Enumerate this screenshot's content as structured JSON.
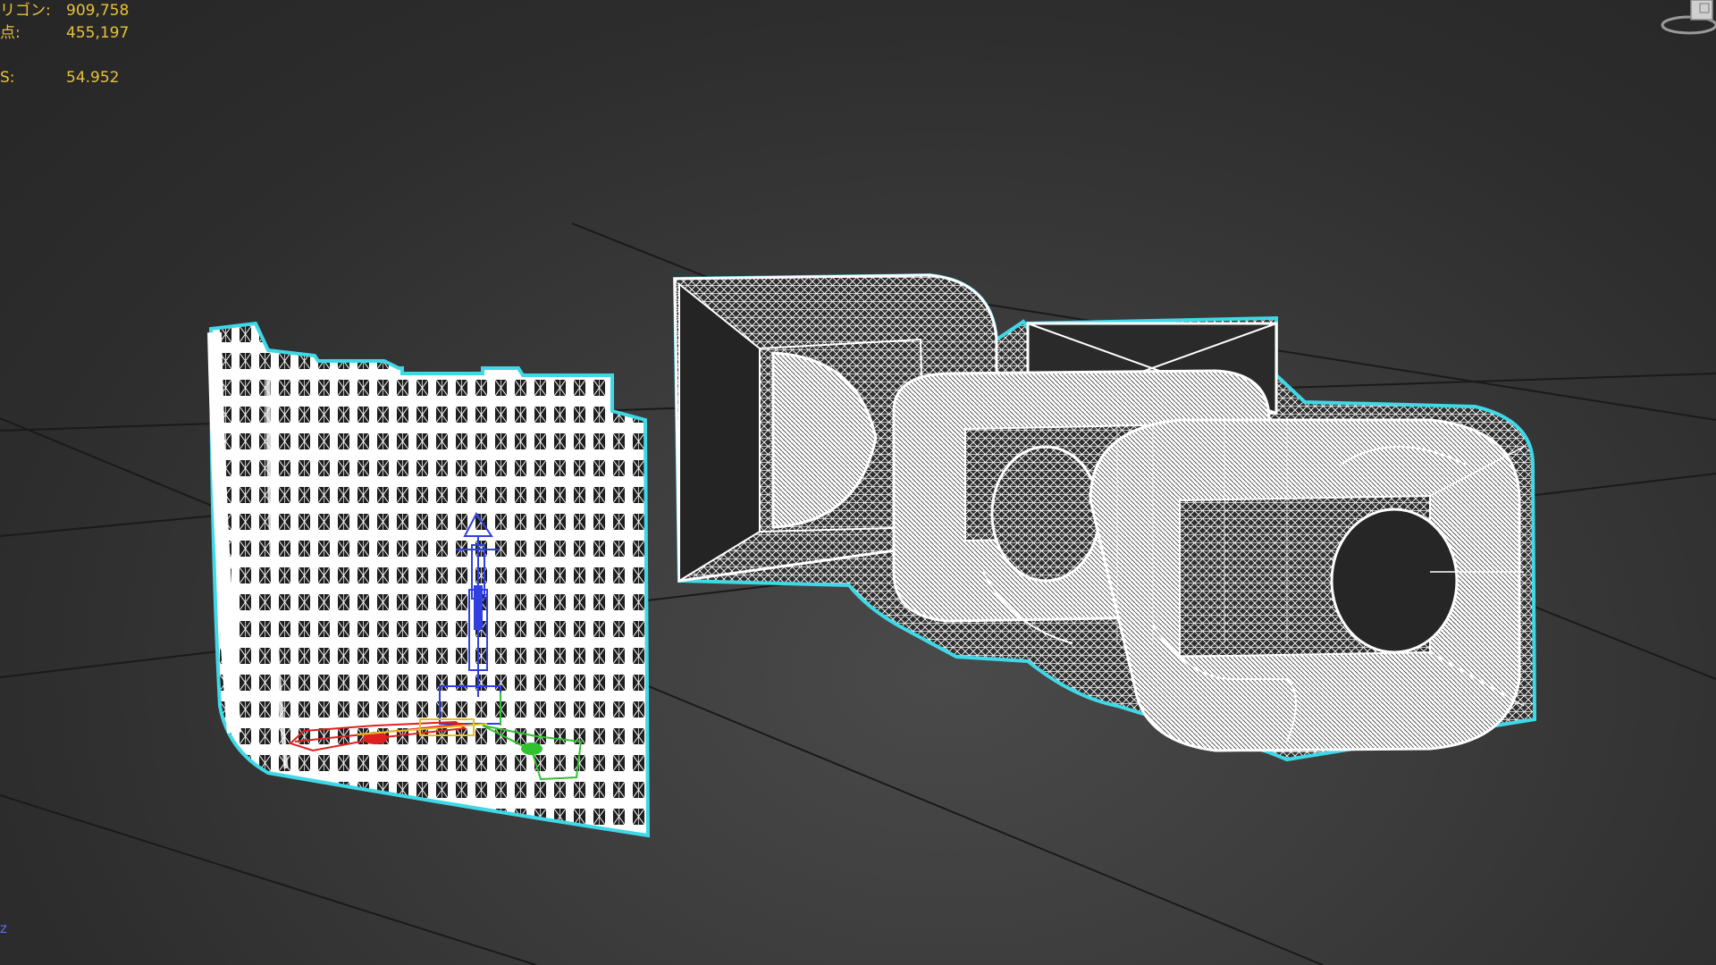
{
  "stats": {
    "polygons": {
      "label": "リゴン:",
      "value": "909,758"
    },
    "vertices": {
      "label": "点:",
      "value": "455,197"
    },
    "fps": {
      "label": "S:",
      "value": "54.952"
    }
  },
  "axis_indicator": {
    "label": "z",
    "color": "#5a6cff"
  },
  "colors": {
    "viewport_bg": "#2b2b2b",
    "grid": "#1a1a1a",
    "wire": "#ffffff",
    "selection_outline": "#3fd8e6",
    "stats_text": "#e6c23b",
    "gizmo_x": "#e02020",
    "gizmo_y": "#30c030",
    "gizmo_z": "#3040e0"
  },
  "objects": [
    {
      "name": "curved-building-facade",
      "selected": true
    },
    {
      "name": "extruded-text-model",
      "selected": true
    },
    {
      "name": "character-rig-gizmo",
      "selected": false
    }
  ],
  "viewcube": {
    "icon": "viewcube-icon"
  }
}
